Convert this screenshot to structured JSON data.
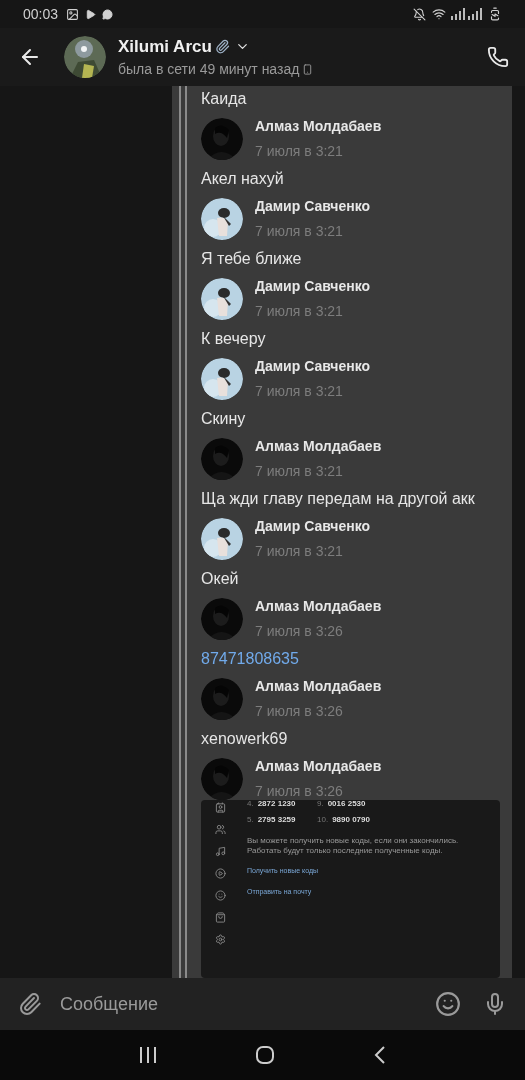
{
  "status_bar": {
    "time": "00:03"
  },
  "header": {
    "name": "Xilumi Arcu",
    "status": "была в сети 49 минут назад"
  },
  "messages": [
    {
      "kind": "text",
      "text": "Каида"
    },
    {
      "kind": "author",
      "name": "Алмаз Молдабаев",
      "date": "7 июля в 3:21",
      "avatar": {
        "kind": "dark"
      }
    },
    {
      "kind": "text",
      "text": "Акел нахуй"
    },
    {
      "kind": "author",
      "name": "Дамир Савченко",
      "date": "7 июля в 3:21",
      "avatar": {
        "kind": "light"
      }
    },
    {
      "kind": "text",
      "text": "Я тебе ближе"
    },
    {
      "kind": "author",
      "name": "Дамир Савченко",
      "date": "7 июля в 3:21",
      "avatar": {
        "kind": "light"
      }
    },
    {
      "kind": "text",
      "text": "К вечеру"
    },
    {
      "kind": "author",
      "name": "Дамир Савченко",
      "date": "7 июля в 3:21",
      "avatar": {
        "kind": "light"
      }
    },
    {
      "kind": "text",
      "text": "Скину"
    },
    {
      "kind": "author",
      "name": "Алмаз Молдабаев",
      "date": "7 июля в 3:21",
      "avatar": {
        "kind": "dark"
      }
    },
    {
      "kind": "text",
      "text": "Ща жди главу передам на другой акк"
    },
    {
      "kind": "author",
      "name": "Дамир Савченко",
      "date": "7 июля в 3:21",
      "avatar": {
        "kind": "light"
      }
    },
    {
      "kind": "text",
      "text": "Окей"
    },
    {
      "kind": "author",
      "name": "Алмаз Молдабаев",
      "date": "7 июля в 3:26",
      "avatar": {
        "kind": "dark"
      }
    },
    {
      "kind": "link",
      "text": "87471808635"
    },
    {
      "kind": "author",
      "name": "Алмаз Молдабаев",
      "date": "7 июля в 3:26",
      "avatar": {
        "kind": "dark"
      }
    },
    {
      "kind": "text",
      "text": "xenowerk69"
    },
    {
      "kind": "author",
      "name": "Алмаз Молдабаев",
      "date": "7 июля в 3:26",
      "avatar": {
        "kind": "dark"
      }
    }
  ],
  "embedded_screenshot": {
    "codes": [
      {
        "number": "4.",
        "code": "2872 1230"
      },
      {
        "number": "9.",
        "code": "0016 2530"
      },
      {
        "number": "5.",
        "code": "2795 3259"
      },
      {
        "number": "10.",
        "code": "9890 0790"
      }
    ],
    "note": "Вы можете получить новые коды, если они закончились. Работать будут только последние полученные коды.",
    "links": [
      "Получить новые коды",
      "Отправить на почту"
    ]
  },
  "composer": {
    "placeholder": "Сообщение"
  }
}
